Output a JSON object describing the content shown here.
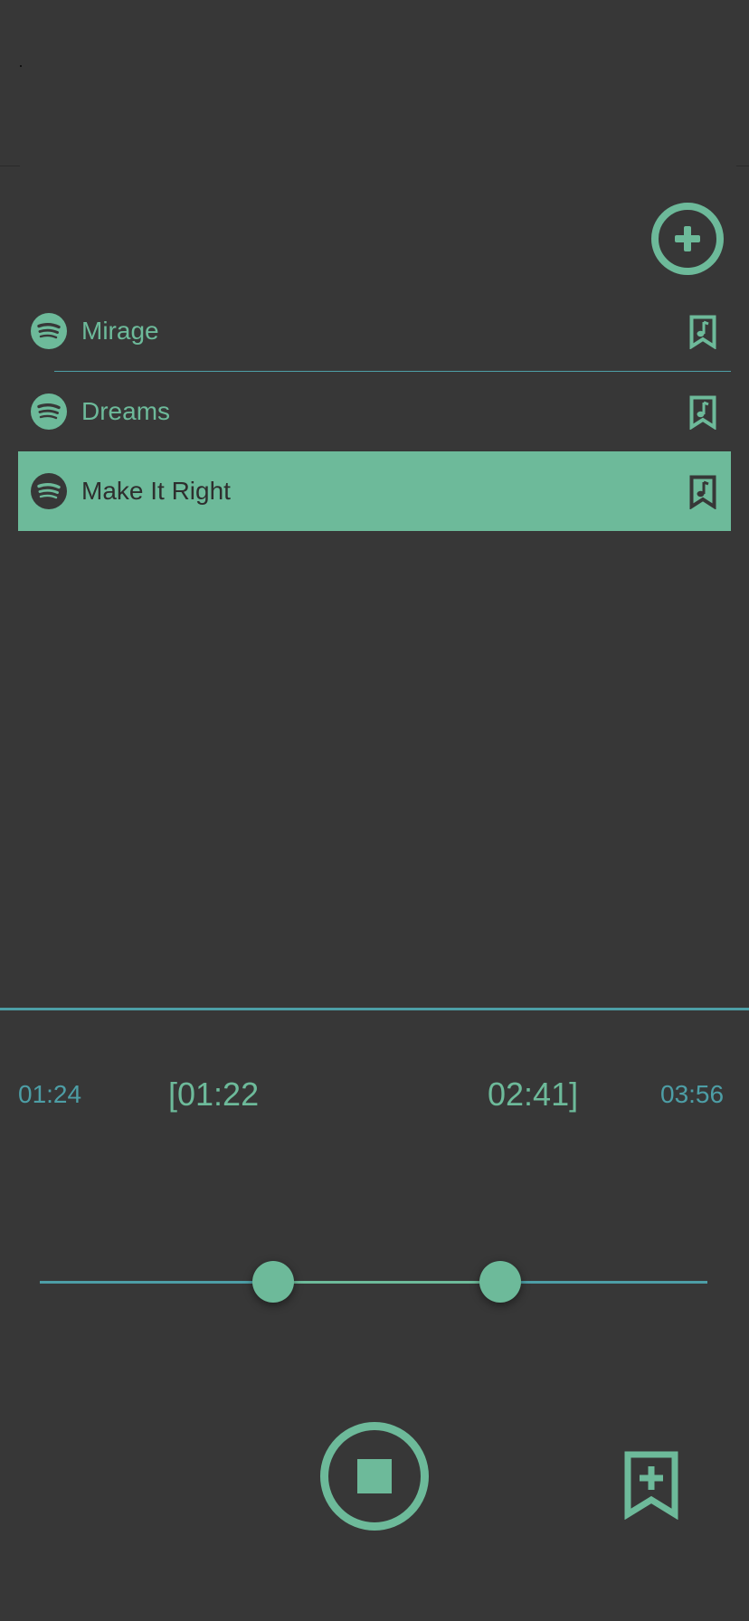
{
  "colors": {
    "background": "#373737",
    "accent": "#6dba9a",
    "accent_secondary": "#4d9ea6",
    "selected_text": "#2e2e2e"
  },
  "header": {
    "add_icon": "plus-circle-icon"
  },
  "tracks": [
    {
      "title": "Mirage",
      "source_icon": "spotify-icon",
      "action_icon": "bookmark-music-icon",
      "selected": false
    },
    {
      "title": "Dreams",
      "source_icon": "spotify-icon",
      "action_icon": "bookmark-music-icon",
      "selected": false
    },
    {
      "title": "Make It Right",
      "source_icon": "spotify-icon",
      "action_icon": "bookmark-music-icon",
      "selected": true
    }
  ],
  "player": {
    "total_start": "01:24",
    "range_start": "[01:22",
    "range_end": "02:41]",
    "total_end": "03:56",
    "range_slider": {
      "start_fraction": 0.35,
      "end_fraction": 0.69
    },
    "stop_icon": "stop-icon",
    "add_bookmark_icon": "bookmark-add-icon"
  }
}
